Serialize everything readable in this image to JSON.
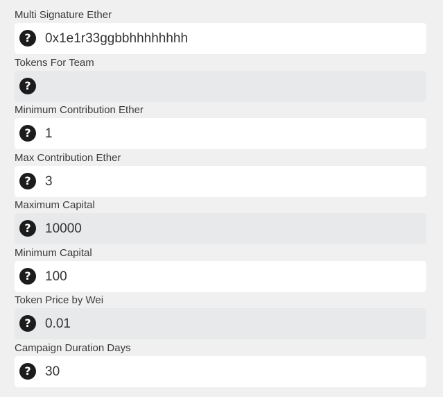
{
  "fields": [
    {
      "label": "Multi Signature Ether",
      "value": "0x1e1r33ggbbhhhhhhhh",
      "readonly": false,
      "icon": "question-circle-icon"
    },
    {
      "label": "Tokens For Team",
      "value": "",
      "readonly": true,
      "icon": "question-circle-icon"
    },
    {
      "label": "Minimum Contribution Ether",
      "value": "1",
      "readonly": false,
      "icon": "question-circle-icon"
    },
    {
      "label": "Max Contribution Ether",
      "value": "3",
      "readonly": false,
      "icon": "question-circle-icon"
    },
    {
      "label": "Maximum Capital",
      "value": "10000",
      "readonly": true,
      "icon": "question-circle-icon"
    },
    {
      "label": "Minimum Capital",
      "value": "100",
      "readonly": false,
      "icon": "question-circle-icon"
    },
    {
      "label": "Token Price by Wei",
      "value": "0.01",
      "readonly": true,
      "icon": "question-circle-icon"
    },
    {
      "label": "Campaign Duration Days",
      "value": "30",
      "readonly": false,
      "icon": "question-circle-icon"
    }
  ],
  "colors": {
    "background": "#f0f0f0",
    "input_bg": "#ffffff",
    "readonly_bg": "#e8e9eb",
    "icon_bg": "#1c1c1c",
    "label_text": "#3a3a3a",
    "value_text": "#333333"
  },
  "help_glyph": "?"
}
